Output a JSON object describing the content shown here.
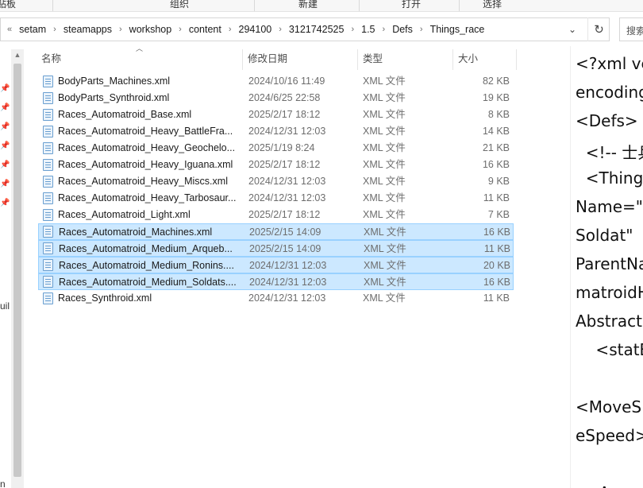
{
  "ribbon": {
    "groups": [
      "贴板",
      "组织",
      "新建",
      "打开",
      "选择"
    ]
  },
  "address": {
    "overflow": "«",
    "crumbs": [
      "setam",
      "steamapps",
      "workshop",
      "content",
      "294100",
      "3121742525",
      "1.5",
      "Defs",
      "Things_race"
    ]
  },
  "search": {
    "placeholder": "搜索"
  },
  "navpane": {
    "fragment1": "uil",
    "fragment2": "n"
  },
  "columns": {
    "name": "名称",
    "date": "修改日期",
    "type": "类型",
    "size": "大小"
  },
  "files": [
    {
      "name": "BodyParts_Machines.xml",
      "date": "2024/10/16 11:49",
      "type": "XML 文件",
      "size": "82 KB",
      "selected": false
    },
    {
      "name": "BodyParts_Synthroid.xml",
      "date": "2024/6/25 22:58",
      "type": "XML 文件",
      "size": "19 KB",
      "selected": false
    },
    {
      "name": "Races_Automatroid_Base.xml",
      "date": "2025/2/17 18:12",
      "type": "XML 文件",
      "size": "8 KB",
      "selected": false
    },
    {
      "name": "Races_Automatroid_Heavy_BattleFra...",
      "date": "2024/12/31 12:03",
      "type": "XML 文件",
      "size": "14 KB",
      "selected": false
    },
    {
      "name": "Races_Automatroid_Heavy_Geochelo...",
      "date": "2025/1/19 8:24",
      "type": "XML 文件",
      "size": "21 KB",
      "selected": false
    },
    {
      "name": "Races_Automatroid_Heavy_Iguana.xml",
      "date": "2025/2/17 18:12",
      "type": "XML 文件",
      "size": "16 KB",
      "selected": false
    },
    {
      "name": "Races_Automatroid_Heavy_Miscs.xml",
      "date": "2024/12/31 12:03",
      "type": "XML 文件",
      "size": "9 KB",
      "selected": false
    },
    {
      "name": "Races_Automatroid_Heavy_Tarbosaur...",
      "date": "2024/12/31 12:03",
      "type": "XML 文件",
      "size": "11 KB",
      "selected": false
    },
    {
      "name": "Races_Automatroid_Light.xml",
      "date": "2025/2/17 18:12",
      "type": "XML 文件",
      "size": "7 KB",
      "selected": false
    },
    {
      "name": "Races_Automatroid_Machines.xml",
      "date": "2025/2/15 14:09",
      "type": "XML 文件",
      "size": "16 KB",
      "selected": true
    },
    {
      "name": "Races_Automatroid_Medium_Arqueb...",
      "date": "2025/2/15 14:09",
      "type": "XML 文件",
      "size": "11 KB",
      "selected": true
    },
    {
      "name": "Races_Automatroid_Medium_Ronins....",
      "date": "2024/12/31 12:03",
      "type": "XML 文件",
      "size": "20 KB",
      "selected": true
    },
    {
      "name": "Races_Automatroid_Medium_Soldats....",
      "date": "2024/12/31 12:03",
      "type": "XML 文件",
      "size": "16 KB",
      "selected": true
    },
    {
      "name": "Races_Synthroid.xml",
      "date": "2024/12/31 12:03",
      "type": "XML 文件",
      "size": "11 KB",
      "selected": false
    }
  ],
  "preview": {
    "lines": [
      "<?xml ve",
      "encoding",
      "<Defs>",
      "  <!-- 士兵",
      "  <Thing",
      "Name=\"",
      "Soldat\"",
      "ParentNa",
      "matroidH",
      "Abstract",
      "    <statB",
      "",
      "<MoveS",
      "eSpeed>",
      "",
      "  <A"
    ]
  }
}
